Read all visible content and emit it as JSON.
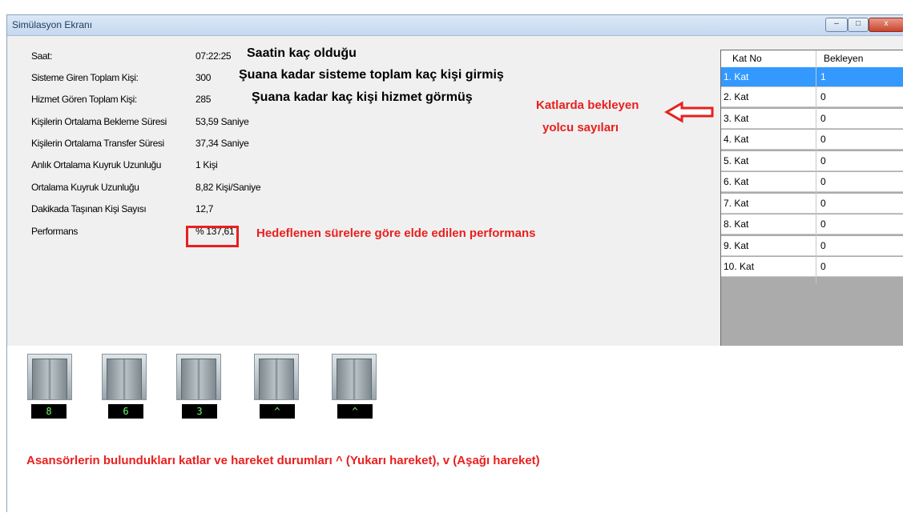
{
  "window": {
    "title": "Simülasyon Ekranı",
    "buttons": [
      "–",
      "□",
      "x"
    ]
  },
  "stats": [
    {
      "label": "Saat:",
      "value": "07:22:25"
    },
    {
      "label": "Sisteme Giren Toplam Kişi:",
      "value": "300"
    },
    {
      "label": "Hizmet Gören Toplam Kişi:",
      "value": "285"
    },
    {
      "label": "Kişilerin Ortalama Bekleme Süresi",
      "value": "53,59  Saniye"
    },
    {
      "label": "Kişilerin Ortalama Transfer Süresi",
      "value": "37,34  Saniye"
    },
    {
      "label": "Anlık Ortalama Kuyruk Uzunluğu",
      "value": "1  Kişi"
    },
    {
      "label": "Ortalama Kuyruk Uzunluğu",
      "value": "8,82  Kişi/Saniye"
    },
    {
      "label": "Dakikada Taşınan Kişi Sayısı",
      "value": "12,7"
    },
    {
      "label": "Performans",
      "value": "% 137,61"
    }
  ],
  "annotations": {
    "clock": "Saatin kaç olduğu",
    "entered": "Şuana kadar sisteme toplam kaç kişi girmiş",
    "served": "Şuana kadar kaç kişi hizmet görmüş",
    "waiting_line1": "Katlarda bekleyen",
    "waiting_line2": "yolcu sayıları",
    "performance": "Hedeflenen sürelere göre elde edilen performans",
    "elevators": "Asansörlerin bulundukları katlar ve hareket durumları ^ (Yukarı hareket),  v (Aşağı hareket)"
  },
  "floor_table": {
    "headers": [
      "Kat No",
      "Bekleyen"
    ],
    "rows": [
      [
        "1. Kat",
        "1"
      ],
      [
        "2. Kat",
        "0"
      ],
      [
        "3. Kat",
        "0"
      ],
      [
        "4. Kat",
        "0"
      ],
      [
        "5. Kat",
        "0"
      ],
      [
        "6. Kat",
        "0"
      ],
      [
        "7. Kat",
        "0"
      ],
      [
        "8. Kat",
        "0"
      ],
      [
        "9. Kat",
        "0"
      ],
      [
        "10. Kat",
        "0"
      ]
    ],
    "selected_row": 0
  },
  "elevators": [
    {
      "status": "8"
    },
    {
      "status": "6"
    },
    {
      "status": "3"
    },
    {
      "status": "^"
    },
    {
      "status": "^"
    }
  ],
  "colors": {
    "annotation_red": "#e8201e",
    "selection_blue": "#3399ff",
    "indicator_green": "#6dfb6d"
  }
}
